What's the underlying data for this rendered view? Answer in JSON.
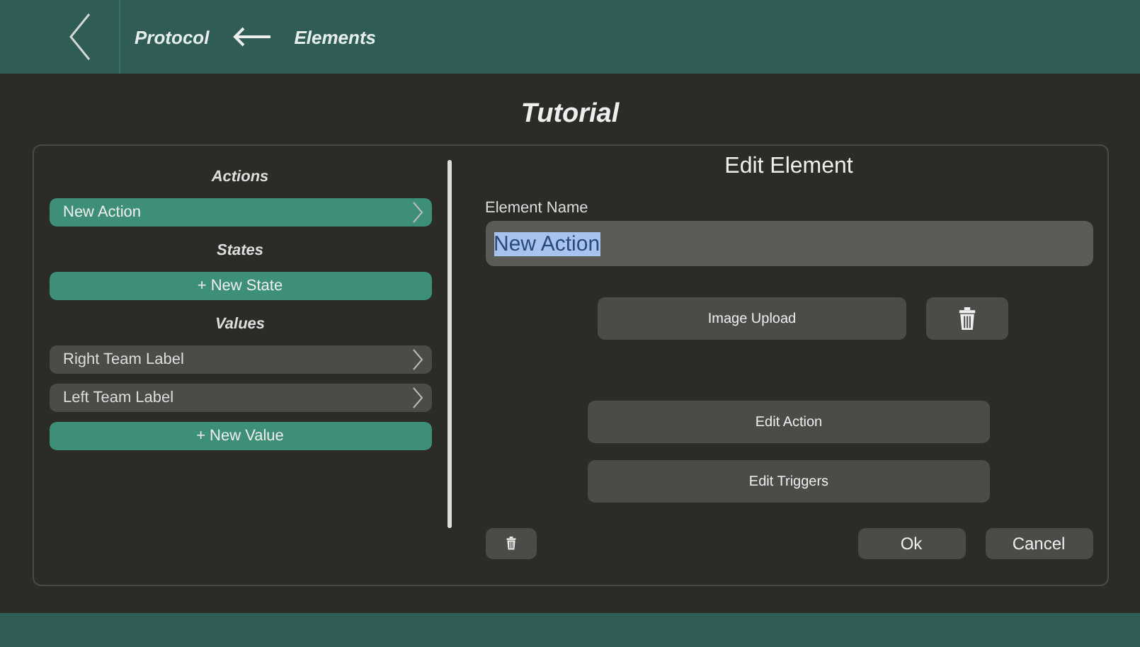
{
  "header": {
    "breadcrumb": [
      {
        "label": "Protocol"
      },
      {
        "label": "Elements"
      }
    ]
  },
  "title": "Tutorial",
  "sections": [
    {
      "heading": "Actions",
      "items": [
        {
          "kind": "item",
          "label": "New Action",
          "selected": true
        }
      ]
    },
    {
      "heading": "States",
      "items": [
        {
          "kind": "add",
          "label": "+ New State"
        }
      ]
    },
    {
      "heading": "Values",
      "items": [
        {
          "kind": "item",
          "label": "Right Team Label",
          "selected": false
        },
        {
          "kind": "item",
          "label": "Left Team Label",
          "selected": false
        },
        {
          "kind": "add",
          "label": "+ New Value"
        }
      ]
    }
  ],
  "editor": {
    "heading": "Edit Element",
    "field_label": "Element Name",
    "field_value": "New Action",
    "value_highlighted": true,
    "image_button": "Image Upload",
    "action_buttons": [
      "Edit Action",
      "Edit Triggers"
    ],
    "ok": "Ok",
    "cancel": "Cancel"
  }
}
